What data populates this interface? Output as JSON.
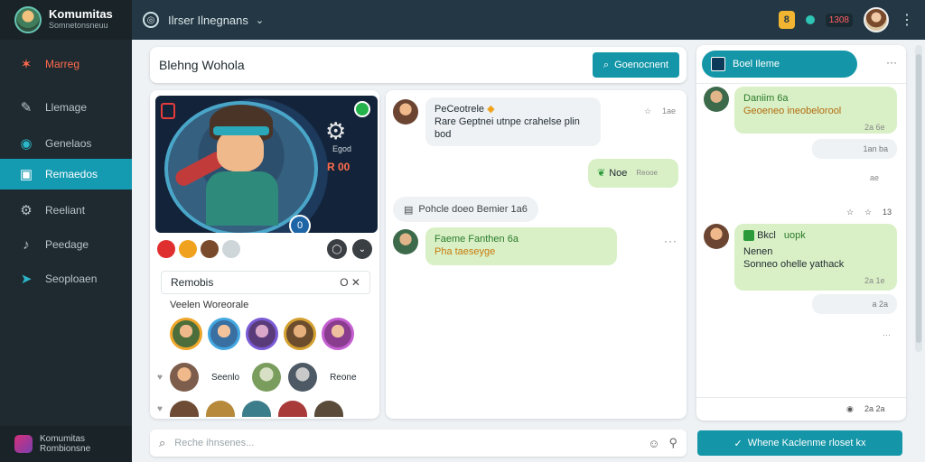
{
  "app": {
    "brand_title": "Komumitas",
    "brand_sub": "Somnetonsneuu",
    "footer_title": "Komumitas",
    "footer_sub": "Rombionsne"
  },
  "sidebar": {
    "items": [
      {
        "label": "Marreg",
        "icon": "dragon-icon"
      },
      {
        "label": "Llemage",
        "icon": "edit-icon"
      },
      {
        "label": "Genelaos",
        "icon": "circle-icon"
      },
      {
        "label": "Remaedos",
        "icon": "panel-icon"
      },
      {
        "label": "Reeliant",
        "icon": "gear-icon"
      },
      {
        "label": "Peedage",
        "icon": "bell-icon"
      },
      {
        "label": "Seoploaen",
        "icon": "send-icon"
      }
    ]
  },
  "topbar": {
    "title": "Ilrser Ilnegnans",
    "badge": "8",
    "count": "1308"
  },
  "header": {
    "title": "Blehng Wohola",
    "button_label": "Goenocnent"
  },
  "hero": {
    "subtitle": "Egod",
    "stat": "R 00",
    "pin": "0"
  },
  "members": {
    "title": "Remobis",
    "subtitle": "Veelen Woreorale",
    "chip_label": "Seenlo",
    "chip_label2": "Reone"
  },
  "chat": {
    "messages": [
      {
        "name": "PeCeotrele",
        "text": "Rare Geptnei utnpe crahelse plin bod",
        "meta": "1ae"
      },
      {
        "name": "Noe",
        "text": "Reooe"
      },
      {
        "system": "Pohcle doeo Bemier 1a6"
      },
      {
        "name": "Faeme Fanthen 6a",
        "text": "Pha taeseyge"
      }
    ]
  },
  "right_panel": {
    "tab_label": "Boel Ileme",
    "messages": [
      {
        "name": "Daniim 6a",
        "text": "Geoeneo ineobelorool",
        "meta": "2a 6e"
      },
      {
        "text": "1an ba",
        "meta": "ae"
      },
      {
        "meta_row": "13"
      },
      {
        "name": "Bkcl",
        "tag": "uopk",
        "line1": "Nenen",
        "line2": "Sonneo ohelle yathack",
        "meta": "2a 1e"
      },
      {
        "text": "a 2a"
      }
    ],
    "footer_meta": "2a 2a"
  },
  "composer": {
    "placeholder": "Reche ihnsenes...",
    "send_label": "Whene Kaclenme rloset kx"
  }
}
